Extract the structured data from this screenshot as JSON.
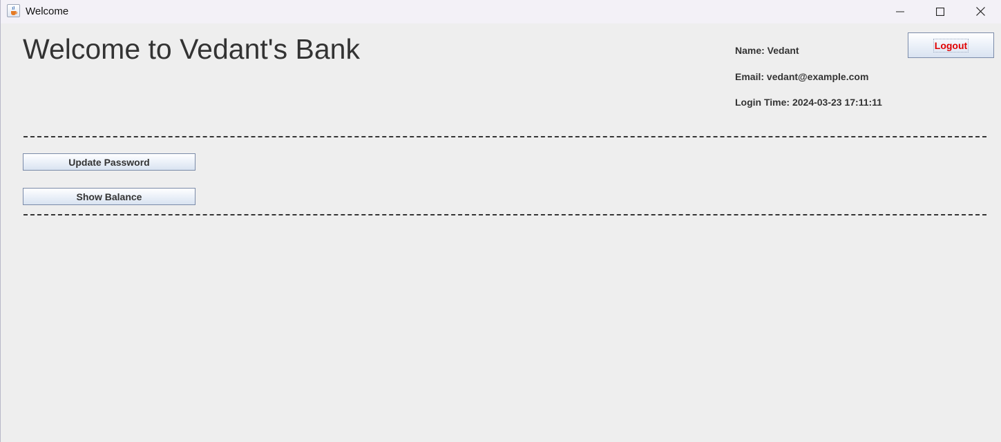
{
  "window": {
    "title": "Welcome",
    "icon": "java-cup-icon"
  },
  "titlebar_controls": {
    "minimize_icon": "minimize-icon",
    "maximize_icon": "maximize-icon",
    "close_icon": "close-icon"
  },
  "main": {
    "heading": "Welcome to Vedant's Bank",
    "user_info": {
      "name_line": "Name: Vedant",
      "email_line": "Email: vedant@example.com",
      "login_time_line": "Login Time: 2024-03-23 17:11:11"
    },
    "logout_label": "Logout",
    "actions": {
      "update_password_label": "Update Password",
      "show_balance_label": "Show Balance"
    }
  },
  "colors": {
    "background": "#eeeeee",
    "text": "#333333",
    "logout_text": "#e00000"
  }
}
